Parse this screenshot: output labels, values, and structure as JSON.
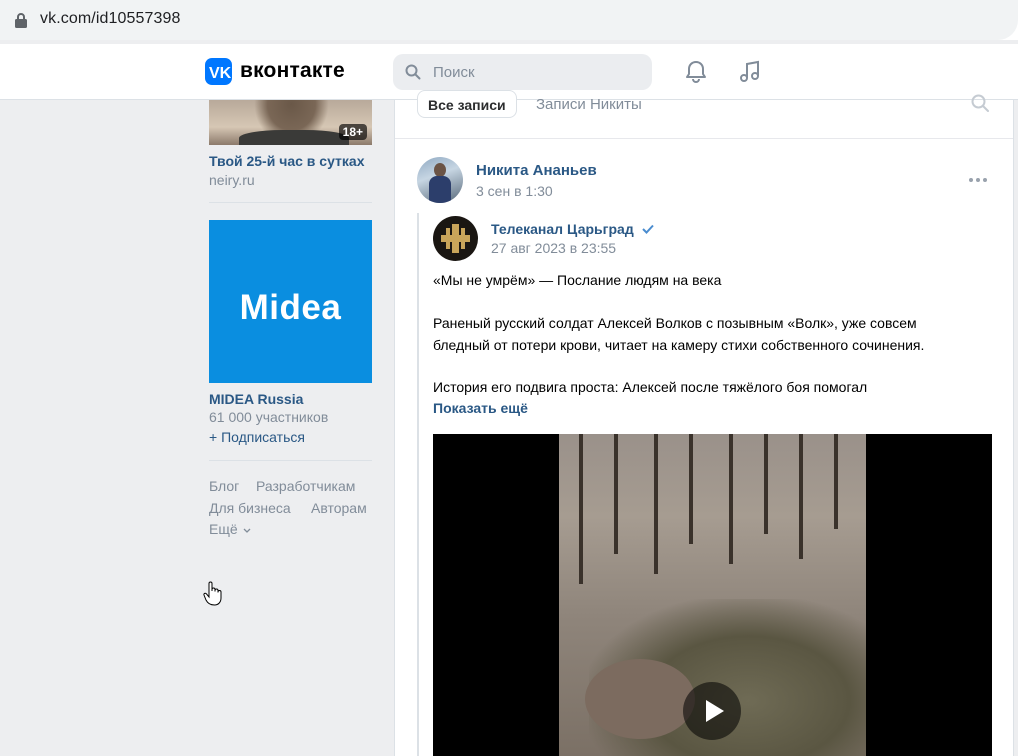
{
  "browser": {
    "url": "vk.com/id10557398"
  },
  "header": {
    "logo_text": "вконтакте",
    "search_placeholder": "Поиск"
  },
  "left": {
    "ad": {
      "badge": "18+",
      "title": "Твой 25-й час в сутках",
      "domain": "neiry.ru"
    },
    "group": {
      "logo": "Midea",
      "name": "MIDEA Russia",
      "members": "61 000 участников",
      "subscribe": "+ Подписаться"
    },
    "footer": {
      "blog": "Блог",
      "developers": "Разработчикам",
      "business": "Для бизнеса",
      "authors": "Авторам",
      "more": "Ещё"
    }
  },
  "wall": {
    "tabs": [
      {
        "label": "Все записи"
      },
      {
        "label": "Записи Никиты"
      }
    ],
    "post": {
      "author": "Никита Ананьев",
      "time": "3 сен в 1:30",
      "repost": {
        "source": "Телеканал Царьград",
        "time": "27 авг 2023 в 23:55",
        "text_title": "«Мы не умрём» — Послание людям на века",
        "text_p1_line1": "Раненый русский солдат Алексей Волков с позывным «Волк», уже совсем",
        "text_p1_line2": "бледный от потери крови, читает на камеру стихи собственного сочинения.",
        "text_p2": "История его подвига проста: Алексей после тяжёлого боя помогал",
        "show_more": "Показать ещё"
      }
    }
  },
  "colors": {
    "accent": "#0077ff",
    "link": "#2a5885",
    "secondary_text": "#818c99",
    "midea_bg": "#0a8ee0"
  }
}
